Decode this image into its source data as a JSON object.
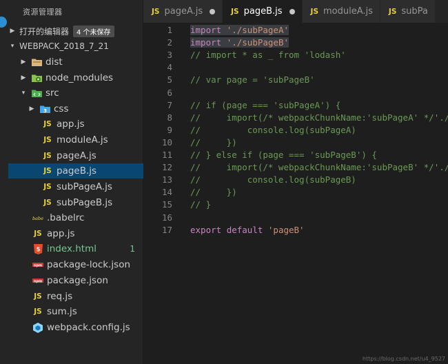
{
  "sidebar": {
    "title": "资源管理器",
    "open_editors_label": "打开的编辑器",
    "unsaved_badge": "4 个未保存",
    "project_label": "WEBPACK_2018_7_21",
    "tree": [
      {
        "label": "dist"
      },
      {
        "label": "node_modules"
      },
      {
        "label": "src"
      },
      {
        "label": "css"
      },
      {
        "label": "app.js"
      },
      {
        "label": "moduleA.js"
      },
      {
        "label": "pageA.js"
      },
      {
        "label": "pageB.js"
      },
      {
        "label": "subPageA.js"
      },
      {
        "label": "subPageB.js"
      },
      {
        "label": ".babelrc"
      },
      {
        "label": "app.js"
      },
      {
        "label": "index.html",
        "git_count": "1"
      },
      {
        "label": "package-lock.json"
      },
      {
        "label": "package.json"
      },
      {
        "label": "req.js"
      },
      {
        "label": "sum.js"
      },
      {
        "label": "webpack.config.js"
      }
    ]
  },
  "tabs": [
    {
      "icon_text": "JS",
      "label": "pageA.js"
    },
    {
      "icon_text": "JS",
      "label": "pageB.js"
    },
    {
      "icon_text": "JS",
      "label": "moduleA.js"
    },
    {
      "icon_text": "JS",
      "label": "subPa"
    }
  ],
  "editor": {
    "line_numbers": [
      "1",
      "2",
      "3",
      "4",
      "5",
      "6",
      "7",
      "8",
      "9",
      "10",
      "11",
      "12",
      "13",
      "14",
      "15",
      "16",
      "17"
    ],
    "lines": [
      {
        "segments": [
          {
            "t": "import",
            "c": "kw"
          },
          {
            "t": " ",
            "c": ""
          },
          {
            "t": "'./subPageA'",
            "c": "str"
          }
        ]
      },
      {
        "segments": [
          {
            "t": "import",
            "c": "kw"
          },
          {
            "t": " ",
            "c": ""
          },
          {
            "t": "'./subPageB'",
            "c": "str"
          }
        ]
      },
      {
        "segments": [
          {
            "t": "// import * as _ from 'lodash'",
            "c": "cm"
          }
        ]
      },
      {
        "segments": []
      },
      {
        "segments": [
          {
            "t": "// var page = 'subPageB'",
            "c": "cm"
          }
        ]
      },
      {
        "segments": []
      },
      {
        "segments": [
          {
            "t": "// if (page === 'subPageA') {",
            "c": "cm"
          }
        ]
      },
      {
        "segments": [
          {
            "t": "//     import(/* webpackChunkName:'subPageA' */'./",
            "c": "cm"
          }
        ]
      },
      {
        "segments": [
          {
            "t": "//         console.log(subPageA)",
            "c": "cm"
          }
        ]
      },
      {
        "segments": [
          {
            "t": "//     })",
            "c": "cm"
          }
        ]
      },
      {
        "segments": [
          {
            "t": "// } else if (page === 'subPageB') {",
            "c": "cm"
          }
        ]
      },
      {
        "segments": [
          {
            "t": "//     import(/* webpackChunkName:'subPageB' */'./",
            "c": "cm"
          }
        ]
      },
      {
        "segments": [
          {
            "t": "//         console.log(subPageB)",
            "c": "cm"
          }
        ]
      },
      {
        "segments": [
          {
            "t": "//     })",
            "c": "cm"
          }
        ]
      },
      {
        "segments": [
          {
            "t": "// }",
            "c": "cm"
          }
        ]
      },
      {
        "segments": []
      },
      {
        "segments": [
          {
            "t": "export",
            "c": "kw"
          },
          {
            "t": " ",
            "c": ""
          },
          {
            "t": "default",
            "c": "kw"
          },
          {
            "t": " ",
            "c": ""
          },
          {
            "t": "'pageB'",
            "c": "str"
          }
        ]
      }
    ]
  },
  "watermark": "https://blog.csdn.net/u4_9527",
  "colors": {
    "accent": "#2d8fd3",
    "selection": "#094771",
    "js_icon": "#e8d03a",
    "html_icon": "#e44d26",
    "npm_icon": "#cb3837",
    "folder": "#dcb67a",
    "git_added": "#73c991"
  },
  "icons": [
    "folder-icon",
    "node-folder-icon",
    "src-folder-icon",
    "css-folder-icon",
    "js-icon",
    "babel-icon",
    "html5-icon",
    "npm-icon",
    "webpack-icon"
  ]
}
